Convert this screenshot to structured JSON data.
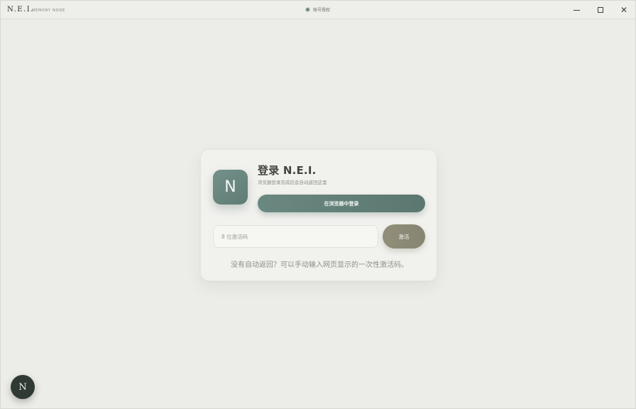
{
  "titlebar": {
    "brand": "N.E.I.",
    "brand_sub": "MEMORY NODE",
    "center_title": "账号授权",
    "controls": {
      "minimize_icon": "minimize-icon",
      "maximize_icon": "maximize-icon",
      "close_icon": "close-icon"
    }
  },
  "login_card": {
    "logo_letter": "N",
    "title": "登录 N.E.I.",
    "subtitle": "浏览器登录完成后会自动返回这里",
    "browser_login_label": "在浏览器中登录",
    "code_input": {
      "value": "",
      "placeholder": "8 位激活码"
    },
    "activate_label": "激活",
    "hint": "没有自动返回？可以手动输入网页显示的一次性激活码。"
  },
  "fab": {
    "letter": "N"
  },
  "colors": {
    "background": "#ecece8",
    "primary": "#6a8880",
    "secondary": "#918f7a",
    "fab": "#2e3a33"
  }
}
